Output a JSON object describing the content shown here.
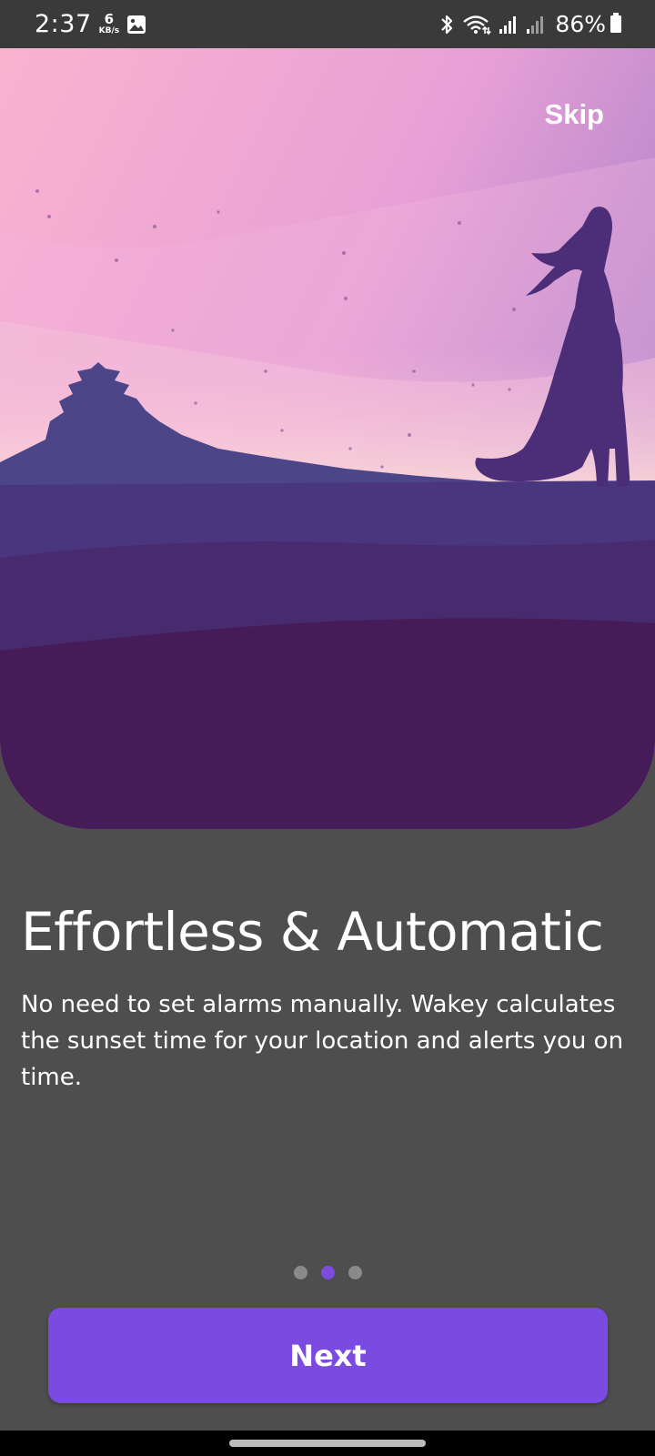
{
  "status_bar": {
    "time": "2:37",
    "net_speed_value": "6",
    "net_speed_unit": "KB/s",
    "battery_percent": "86%",
    "icons": [
      "gallery-icon",
      "bluetooth-icon",
      "wifi-icon",
      "signal-icon",
      "signal-icon",
      "battery-icon"
    ]
  },
  "onboarding": {
    "skip_label": "Skip",
    "title": "Effortless & Automatic",
    "description": "No need to set alarms manually. Wakey calculates the sunset time for your location and alerts you on time.",
    "page_count": 3,
    "current_page": 2,
    "next_label": "Next"
  },
  "colors": {
    "background": "#4e4e4e",
    "accent": "#7b4ae0",
    "inactive_dot": "#8a8a8a"
  }
}
